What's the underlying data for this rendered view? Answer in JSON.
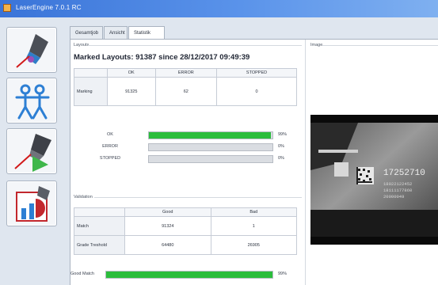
{
  "window": {
    "title": "LaserEngine 7.0.1 RC"
  },
  "sidebar": [
    {
      "name": "engrave-tool-icon"
    },
    {
      "name": "users-icon"
    },
    {
      "name": "run-marking-icon"
    },
    {
      "name": "statistics-chart-icon"
    }
  ],
  "tabs": [
    {
      "label": "Gesamtjob"
    },
    {
      "label": "Ansicht"
    },
    {
      "label": "Statistik"
    }
  ],
  "layouts": {
    "group_label": "Layouts",
    "title": "Marked Layouts: 91387 since 28/12/2017 09:49:39",
    "columns": [
      "",
      "OK",
      "ERROR",
      "STOPPED"
    ],
    "rows": [
      {
        "label": "Marking",
        "ok": "91325",
        "error": "62",
        "stopped": "0"
      }
    ]
  },
  "bars": [
    {
      "label": "OK",
      "fraction": 0.99,
      "pct_text": "99%"
    },
    {
      "label": "ERROR",
      "fraction": 0.0,
      "pct_text": "0%"
    },
    {
      "label": "STOPPED",
      "fraction": 0.0,
      "pct_text": "0%"
    }
  ],
  "validation": {
    "group_label": "Validation",
    "columns": [
      "",
      "Good",
      "Bad"
    ],
    "rows": [
      {
        "label": "Match",
        "good": "91324",
        "bad": "1"
      },
      {
        "label": "Grade Treshold",
        "good": "64480",
        "bad": "26905"
      }
    ]
  },
  "good_match": {
    "label": "Good Match",
    "fraction": 1.0,
    "pct_text": "99%"
  },
  "image": {
    "group_label": "Image",
    "text_lines": [
      "17252710",
      "18022122452",
      "18111177860",
      "20000049"
    ]
  },
  "colors": {
    "bar_fill": "#2bbd3c",
    "bar_track": "#dadde2",
    "titlebar": "#3a74d8"
  }
}
